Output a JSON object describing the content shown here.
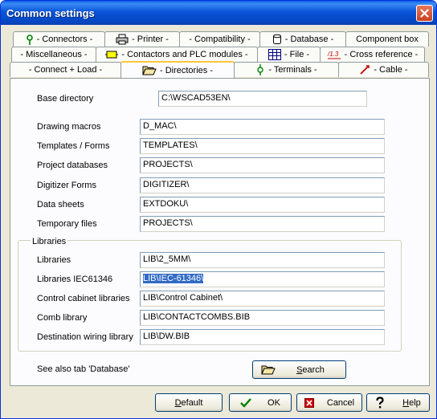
{
  "window": {
    "title": "Common settings"
  },
  "tabs": {
    "row1": [
      {
        "label": "- Connectors -",
        "icon": "connector-icon"
      },
      {
        "label": "- Printer -",
        "icon": "printer-icon"
      },
      {
        "label": "- Compatibility -"
      },
      {
        "label": "- Database -",
        "icon": "database-icon"
      },
      {
        "label": "Component box"
      }
    ],
    "row2": [
      {
        "label": "- Miscellaneous -"
      },
      {
        "label": "- Contactors and PLC modules -",
        "icon": "contactor-icon"
      },
      {
        "label": "- File -",
        "icon": "file-icon"
      },
      {
        "label": "- Cross reference -",
        "icon": "cross-reference-icon"
      }
    ],
    "row3": [
      {
        "label": "- Connect + Load -"
      },
      {
        "label": "- Directories -",
        "icon": "folder-open-icon",
        "active": true
      },
      {
        "label": "- Terminals -",
        "icon": "terminal-icon"
      },
      {
        "label": "- Cable -",
        "icon": "cable-icon"
      }
    ]
  },
  "directories": {
    "base": {
      "label": "Base directory",
      "value": "C:\\WSCAD53EN\\"
    },
    "fields": [
      {
        "label": "Drawing macros",
        "value": "D_MAC\\"
      },
      {
        "label": "Templates / Forms",
        "value": "TEMPLATES\\"
      },
      {
        "label": "Project databases",
        "value": "PROJECTS\\"
      },
      {
        "label": "Digitizer Forms",
        "value": "DIGITIZER\\"
      },
      {
        "label": "Data sheets",
        "value": "EXTDOKU\\"
      },
      {
        "label": "Temporary files",
        "value": "PROJECTS\\"
      }
    ]
  },
  "libraries": {
    "group_label": "Libraries",
    "fields": [
      {
        "label": "Libraries",
        "value": "LIB\\2_5MM\\"
      },
      {
        "label": "Libraries IEC61346",
        "value": "LIB\\IEC-61346\\"
      },
      {
        "label": "Control cabinet libraries",
        "value": "LIB\\Control Cabinet\\"
      },
      {
        "label": "Comb library",
        "value": "LIB\\CONTACTCOMBS.BIB"
      },
      {
        "label": "Destination wiring library",
        "value": "LIB\\DW.BIB"
      }
    ]
  },
  "see_also": "See also tab 'Database'",
  "search_button": {
    "label": "Search",
    "hotkey": "S",
    "rest": "earch"
  },
  "footer": {
    "default": {
      "hotkey": "D",
      "rest": "efault"
    },
    "ok": {
      "label": "OK"
    },
    "cancel": {
      "label": "Cancel"
    },
    "help": {
      "hotkey": "H",
      "rest": "elp"
    }
  },
  "colors": {
    "titlebar": "#0a55d8",
    "selection": "#316ac5",
    "button_border": "#003c74"
  }
}
